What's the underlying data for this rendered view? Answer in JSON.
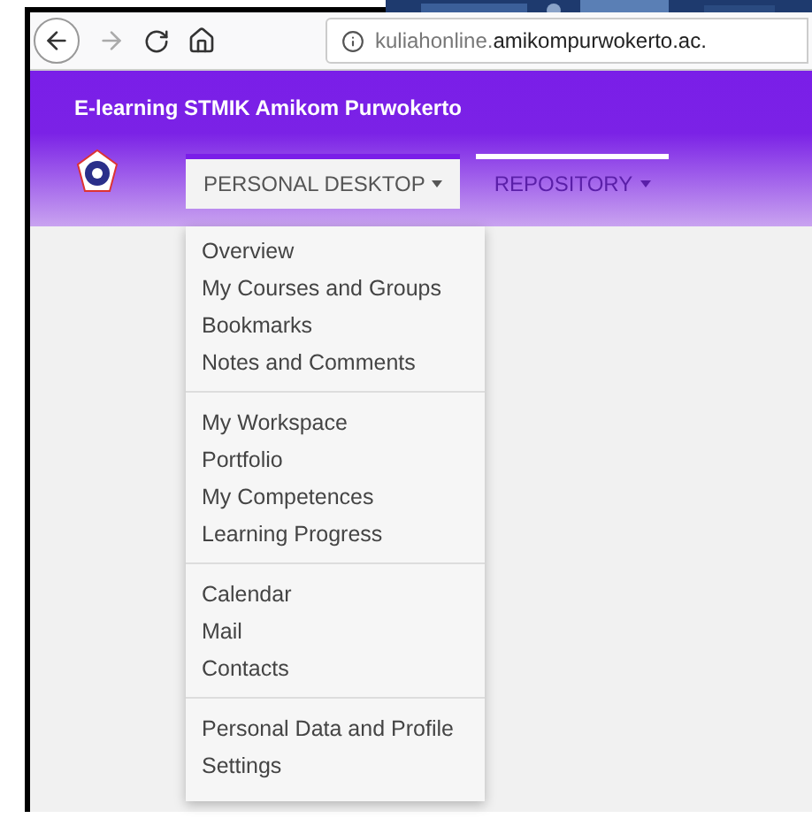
{
  "browser": {
    "url_subdomain": "kuliahonline.",
    "url_domain": "amikompurwokerto.ac."
  },
  "header": {
    "title": "E-learning STMIK Amikom Purwokerto"
  },
  "tabs": [
    {
      "label": "PERSONAL DESKTOP",
      "selected": true
    },
    {
      "label": "REPOSITORY",
      "selected": false
    }
  ],
  "menu": {
    "groups": [
      [
        "Overview",
        "My Courses and Groups",
        "Bookmarks",
        "Notes and Comments"
      ],
      [
        "My Workspace",
        "Portfolio",
        "My Competences",
        "Learning Progress"
      ],
      [
        "Calendar",
        "Mail",
        "Contacts"
      ],
      [
        "Personal Data and Profile",
        "Settings"
      ]
    ]
  }
}
